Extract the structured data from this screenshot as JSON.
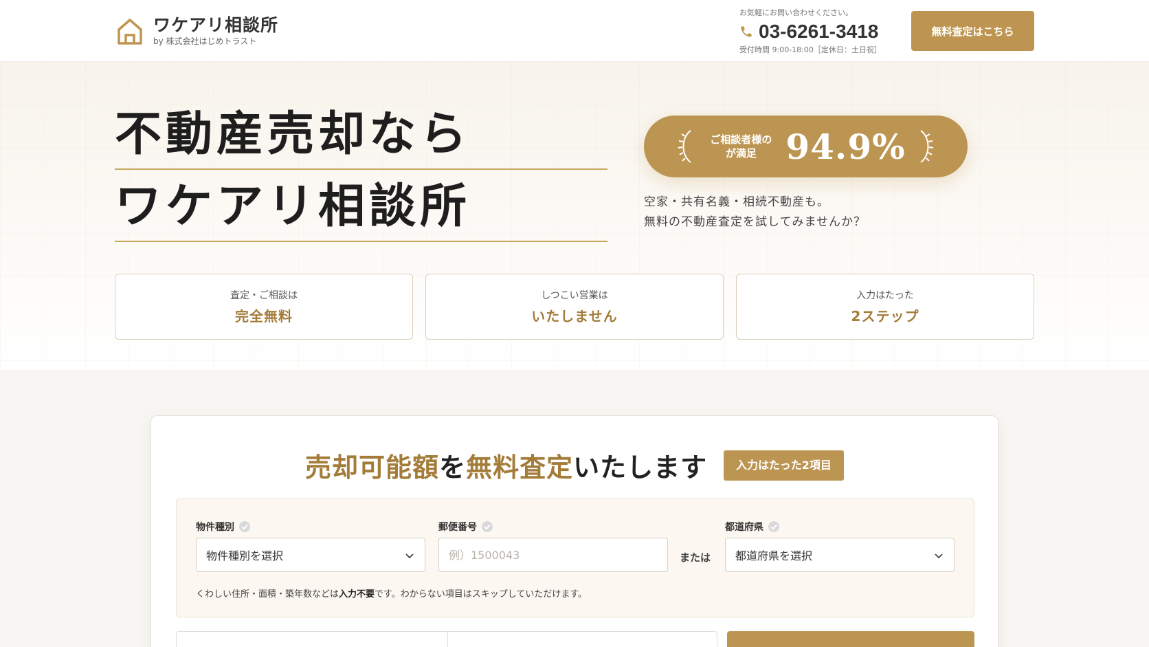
{
  "header": {
    "logo_title": "ワケアリ相談所",
    "logo_sub": "by 株式会社はじめトラスト",
    "contact_note": "お気軽にお問い合わせください。",
    "phone": "03-6261-3418",
    "hours": "受付時間 9:00-18:00［定休日：土日祝］",
    "cta_label": "無料査定はこちら"
  },
  "hero": {
    "headline_line1": "不動産売却なら",
    "headline_line2": "ワケアリ相談所",
    "badge_label": "ご相談者様の\nが満足",
    "badge_value": "94.9%",
    "desc_line1": "空家・共有名義・相続不動産も。",
    "desc_line2": "無料の不動産査定を試してみませんか？",
    "features": [
      {
        "small": "査定・ご相談は",
        "big": "完全無料"
      },
      {
        "small": "しつこい営業は",
        "big": "いたしません"
      },
      {
        "small": "入力はたった",
        "big": "2ステップ"
      }
    ]
  },
  "form": {
    "title_part1": "売却可能額",
    "title_part2": "を",
    "title_part3": "無料査定",
    "title_part4": "いたします",
    "pill": "入力はたった2項目",
    "property_label": "物件種別",
    "property_value": "物件種別を選択",
    "postal_label": "郵便番号",
    "postal_placeholder": "例）1500043",
    "or_text": "または",
    "pref_label": "都道府県",
    "pref_value": "都道府県を選択",
    "help_pre": "くわしい住所・面積・築年数などは",
    "help_bold": "入力不要",
    "help_post": "です。わからない項目はスキップしていただけます。"
  },
  "colors": {
    "accent": "#bd9552",
    "accent_text": "#a47c3a",
    "hero_bg": "#f8f4ec"
  },
  "icons": [
    "house-logo-icon",
    "phone-icon",
    "laurel-left-icon",
    "laurel-right-icon",
    "check-circle-icon",
    "chevron-down-icon"
  ]
}
